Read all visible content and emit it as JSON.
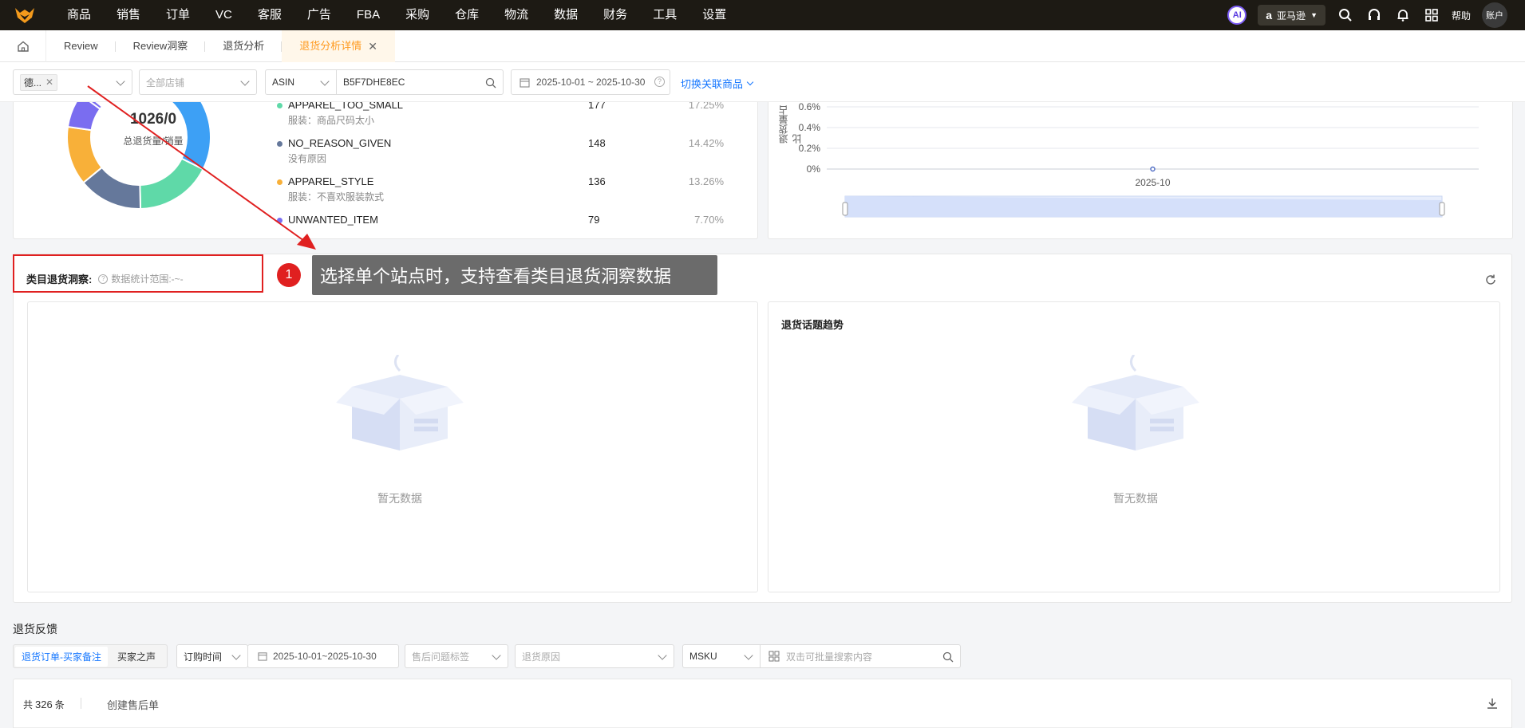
{
  "topnav": {
    "menu": [
      "商品",
      "销售",
      "订单",
      "VC",
      "客服",
      "广告",
      "FBA",
      "采购",
      "仓库",
      "物流",
      "数据",
      "财务",
      "工具",
      "设置"
    ],
    "ai_label": "AI",
    "platform_icon": "a",
    "platform": "亚马逊",
    "help": "帮助",
    "account": "账户"
  },
  "tabs": {
    "items": [
      "Review",
      "Review洞察",
      "退货分析"
    ],
    "active": "退货分析详情"
  },
  "filters": {
    "site_tag": "德...",
    "store_placeholder": "全部店铺",
    "search_type": "ASIN",
    "search_value": "B5F7DHE8EC",
    "date_range": "2025-10-01 ~ 2025-10-30",
    "switch_link": "切换关联商品"
  },
  "donut": {
    "value": "1026/0",
    "label": "总退货量/销量",
    "slices": [
      {
        "color": "#3da0f5",
        "fraction": 0.3
      },
      {
        "color": "#5fd9a8",
        "fraction": 0.1725
      },
      {
        "color": "#65789b",
        "fraction": 0.1442
      },
      {
        "color": "#f8b039",
        "fraction": 0.1326
      },
      {
        "color": "#7a6df0",
        "fraction": 0.077
      },
      {
        "color": "#7a6df0",
        "fraction": 0.01
      }
    ]
  },
  "reasons": [
    {
      "code": "APPAREL_TOO_SMALL",
      "desc": "服装：商品尺码太小",
      "count": "177",
      "pct": "17.25%",
      "color": "#5fd9a8"
    },
    {
      "code": "NO_REASON_GIVEN",
      "desc": "没有原因",
      "count": "148",
      "pct": "14.42%",
      "color": "#65789b"
    },
    {
      "code": "APPAREL_STYLE",
      "desc": "服装：不喜欢服装款式",
      "count": "136",
      "pct": "13.26%",
      "color": "#f8b039"
    },
    {
      "code": "UNWANTED_ITEM",
      "desc": "",
      "count": "79",
      "pct": "7.70%",
      "color": "#7a6df0"
    }
  ],
  "chart_data": {
    "type": "line",
    "ylabel": "退货量占比",
    "y_ticks": [
      "0.6%",
      "0.4%",
      "0.2%",
      "0%"
    ],
    "x": [
      "2025-10"
    ],
    "series": [
      {
        "values": [
          0
        ]
      }
    ]
  },
  "category_section": {
    "title": "类目退货洞察:",
    "note": "数据统计范围:-~-",
    "trend_title": "退货话题趋势",
    "empty_left": "暂无数据",
    "empty_right": "暂无数据"
  },
  "annotation": {
    "step": "1",
    "text": "选择单个站点时，支持查看类目退货洞察数据"
  },
  "feedback": {
    "title": "退货反馈",
    "toggle_active": "退货订单-买家备注",
    "toggle_other": "买家之声",
    "time_type": "订购时间",
    "date_range": "2025-10-01~2025-10-30",
    "tag_placeholder": "售后问题标签",
    "reason_placeholder": "退货原因",
    "sku_type": "MSKU",
    "search_placeholder": "双击可批量搜索内容",
    "total_prefix": "共",
    "total_count": "326",
    "total_suffix": "条",
    "create_link": "创建售后单"
  }
}
